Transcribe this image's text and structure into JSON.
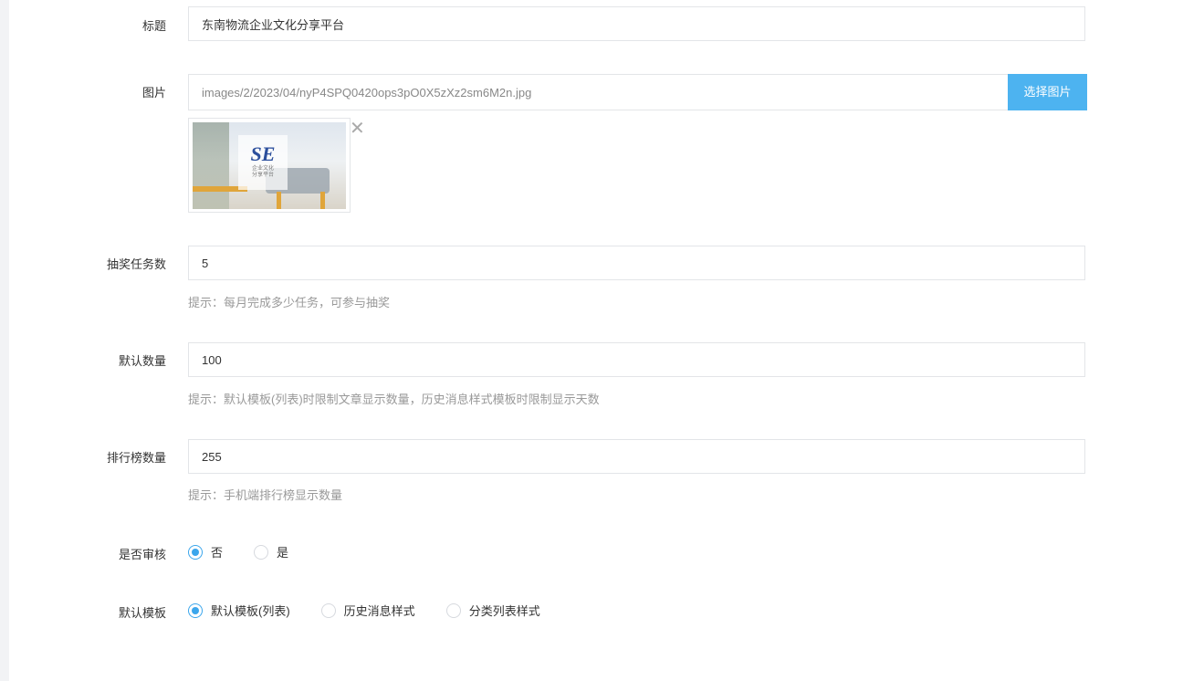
{
  "form": {
    "title": {
      "label": "标题",
      "value": "东南物流企业文化分享平台"
    },
    "image": {
      "label": "图片",
      "value": "images/2/2023/04/nyP4SPQ0420ops3pO0X5zXz2sm6M2n.jpg",
      "select_button": "选择图片",
      "remove_icon": "close-icon",
      "logo_text": "SE",
      "logo_sub1": "企业文化",
      "logo_sub2": "分享平台"
    },
    "lottery_tasks": {
      "label": "抽奖任务数",
      "value": "5",
      "hint": "提示：每月完成多少任务，可参与抽奖"
    },
    "default_count": {
      "label": "默认数量",
      "value": "100",
      "hint": "提示：默认模板(列表)时限制文章显示数量，历史消息样式模板时限制显示天数"
    },
    "ranking_count": {
      "label": "排行榜数量",
      "value": "255",
      "hint": "提示：手机端排行榜显示数量"
    },
    "review": {
      "label": "是否审核",
      "options": [
        "否",
        "是"
      ],
      "selected": "否"
    },
    "template": {
      "label": "默认模板",
      "options": [
        "默认模板(列表)",
        "历史消息样式",
        "分类列表样式"
      ],
      "selected": "默认模板(列表)"
    }
  },
  "colors": {
    "accent": "#4db3f0",
    "radio_checked": "#3ba6ec",
    "border": "#e3e5e8",
    "hint": "#999999"
  }
}
